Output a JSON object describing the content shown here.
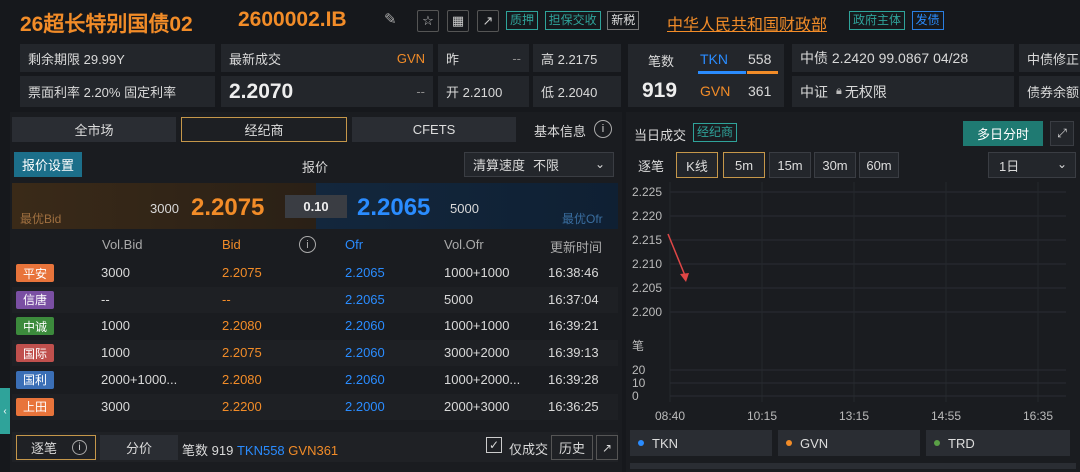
{
  "header": {
    "bond_name": "26超长特别国债02",
    "bond_code": "2600002.IB",
    "tags": [
      "质押",
      "担保交收",
      "新税"
    ],
    "issuer": "中华人民共和国财政部",
    "issuer_tags": [
      "政府主体",
      "发债"
    ]
  },
  "info": {
    "remaining_term": "剩余期限 29.99Y",
    "coupon": "票面利率 2.20% 固定利率",
    "last_trade_label": "最新成交",
    "last_trade_source": "GVN",
    "last_trade_value": "2.2070",
    "last_trade_dash": "--",
    "prev_label": "昨",
    "prev_value": "--",
    "open": "开 2.2100",
    "high": "高 2.2175",
    "low": "低 2.2040",
    "count_label": "笔数",
    "count_value": "919",
    "tkn_label": "TKN",
    "tkn_count": "558",
    "gvn_label": "GVN",
    "gvn_count": "361",
    "chinabond": "中债 2.2420 99.0867 04/28",
    "chinabond_modify": "中债修正",
    "csi": "中证",
    "csi_value": "无权限",
    "bond_balance": "债券余额"
  },
  "left_tabs": [
    "全市场",
    "经纪商",
    "CFETS"
  ],
  "basic_info": "基本信息",
  "quote": {
    "settings_btn": "报价设置",
    "label": "报价",
    "clearing_label": "清算速度",
    "clearing_value": "不限",
    "best_bid_label": "最优Bid",
    "best_ofr_label": "最优Ofr",
    "bid_vol": "3000",
    "bid": "2.2075",
    "spread": "0.10",
    "ofr": "2.2065",
    "ofr_vol": "5000"
  },
  "table": {
    "headers": [
      "Vol.Bid",
      "Bid",
      "Ofr",
      "Vol.Ofr",
      "更新时间"
    ],
    "rows": [
      {
        "broker": "平安",
        "color": "#e8743b",
        "vol_bid": "3000",
        "bid": "2.2075",
        "ofr": "2.2065",
        "vol_ofr": "1000+1000",
        "time": "16:38:46"
      },
      {
        "broker": "信唐",
        "color": "#7a4fa3",
        "vol_bid": "--",
        "bid": "--",
        "ofr": "2.2065",
        "vol_ofr": "5000",
        "time": "16:37:04"
      },
      {
        "broker": "中诚",
        "color": "#3c8a3c",
        "vol_bid": "1000",
        "bid": "2.2080",
        "ofr": "2.2060",
        "vol_ofr": "1000+1000",
        "time": "16:39:21"
      },
      {
        "broker": "国际",
        "color": "#c0504d",
        "vol_bid": "1000",
        "bid": "2.2075",
        "ofr": "2.2060",
        "vol_ofr": "3000+2000",
        "time": "16:39:13"
      },
      {
        "broker": "国利",
        "color": "#3b6fb6",
        "vol_bid": "2000+1000...",
        "bid": "2.2080",
        "ofr": "2.2060",
        "vol_ofr": "1000+2000...",
        "time": "16:39:28"
      },
      {
        "broker": "上田",
        "color": "#e8743b",
        "vol_bid": "3000",
        "bid": "2.2200",
        "ofr": "2.2000",
        "vol_ofr": "2000+3000",
        "time": "16:36:25"
      }
    ]
  },
  "bottom": {
    "tick_btn": "逐笔",
    "price_btn": "分价",
    "count_label": "笔数",
    "count": "919",
    "tkn": "TKN",
    "tkn_count": "558",
    "gvn": "GVN",
    "gvn_count": "361",
    "only_trade": "仅成交",
    "history": "历史"
  },
  "right": {
    "today_label": "当日成交",
    "broker_tag": "经纪商",
    "multi_day": "多日分时",
    "tabs": [
      "逐笔",
      "K线",
      "5m",
      "15m",
      "30m",
      "60m"
    ],
    "period": "1日",
    "y_ticks": [
      "2.225",
      "2.220",
      "2.215",
      "2.210",
      "2.205",
      "2.200"
    ],
    "vol_label": "笔",
    "vol_ticks": [
      "20",
      "10",
      "0"
    ],
    "x_ticks": [
      "08:40",
      "10:15",
      "13:15",
      "14:55",
      "16:35"
    ],
    "legend": [
      {
        "name": "TKN",
        "color": "#2a8cff"
      },
      {
        "name": "GVN",
        "color": "#f28c28"
      },
      {
        "name": "TRD",
        "color": "#5aa046"
      }
    ]
  },
  "colors": {
    "up": "#e04646",
    "down": "#23b860",
    "accent": "#f28c28",
    "blue": "#2a8cff"
  }
}
